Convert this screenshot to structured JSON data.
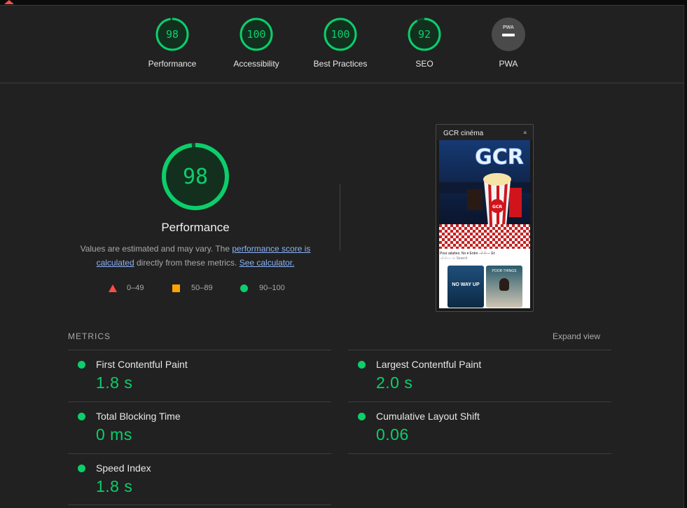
{
  "categories": [
    {
      "label": "Performance",
      "score": "98",
      "value": 98
    },
    {
      "label": "Accessibility",
      "score": "100",
      "value": 100
    },
    {
      "label": "Best Practices",
      "score": "100",
      "value": 100
    },
    {
      "label": "SEO",
      "score": "92",
      "value": 92
    }
  ],
  "pwa": {
    "label": "PWA",
    "badge": "PWA"
  },
  "main": {
    "score": "98",
    "value": 98,
    "title": "Performance",
    "desc_pre": "Values are estimated and may vary. The ",
    "desc_link1": "performance score is calculated",
    "desc_mid": " directly from these metrics. ",
    "desc_link2": "See calculator."
  },
  "legend": {
    "fail": "0–49",
    "average": "50–89",
    "pass": "90–100"
  },
  "screenshot": {
    "site_title": "GCR cinéma",
    "menu_icon": "≡",
    "hero_text": "GCR",
    "cup_text": "GCR",
    "form_line1": "Pour adultes: No ▾ Entre ‑‑/‑‑/‑‑‑‑ Et:",
    "form_line2": "‑‑/‑‑/‑‑‑‑ ▭ Search",
    "poster1": "NO WAY UP",
    "poster2": "POOR THINGS"
  },
  "metrics": {
    "heading": "METRICS",
    "expand": "Expand view",
    "items": [
      {
        "name": "First Contentful Paint",
        "value": "1.8 s"
      },
      {
        "name": "Largest Contentful Paint",
        "value": "2.0 s"
      },
      {
        "name": "Total Blocking Time",
        "value": "0 ms"
      },
      {
        "name": "Cumulative Layout Shift",
        "value": "0.06"
      },
      {
        "name": "Speed Index",
        "value": "1.8 s"
      }
    ]
  },
  "colors": {
    "pass": "#0cce6b",
    "average": "#ffa400",
    "fail": "#ff4e42",
    "background": "#212121"
  }
}
